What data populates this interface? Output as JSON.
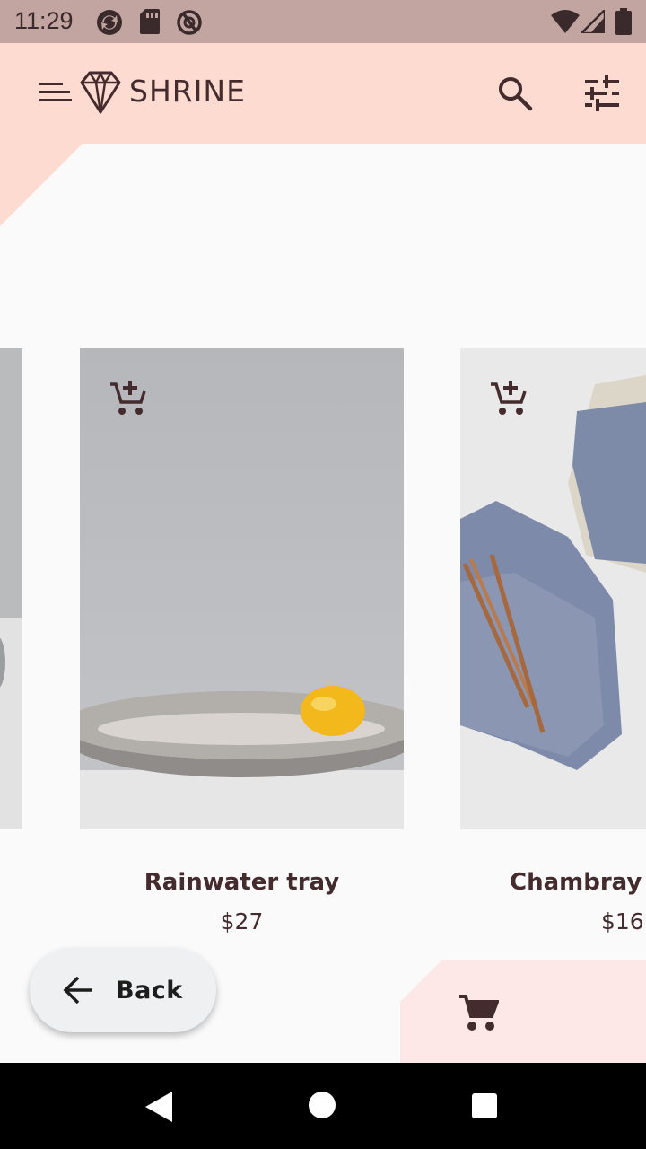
{
  "status_bar": {
    "time": "11:29",
    "left_icons": [
      "sync-icon",
      "sd-card-icon",
      "at-sign-icon"
    ],
    "right_icons": [
      "wifi-icon",
      "signal-icon",
      "battery-icon"
    ]
  },
  "app_bar": {
    "title": "SHRINE",
    "icons": [
      "menu-icon",
      "shrine-logo-icon",
      "search-icon",
      "tune-icon"
    ],
    "background": "#fedbd0"
  },
  "products": [
    {
      "name": "Rainwater tray",
      "price": "$27"
    },
    {
      "name": "Chambray r",
      "price": "$16"
    }
  ],
  "back_button": {
    "label": "Back"
  },
  "cart": {
    "icon": "shopping-cart-icon"
  },
  "colors": {
    "primary": "#fedbd0",
    "secondary_surface": "#fde7e7",
    "text": "#442c2e",
    "status_bar": "#c2a5a1"
  }
}
